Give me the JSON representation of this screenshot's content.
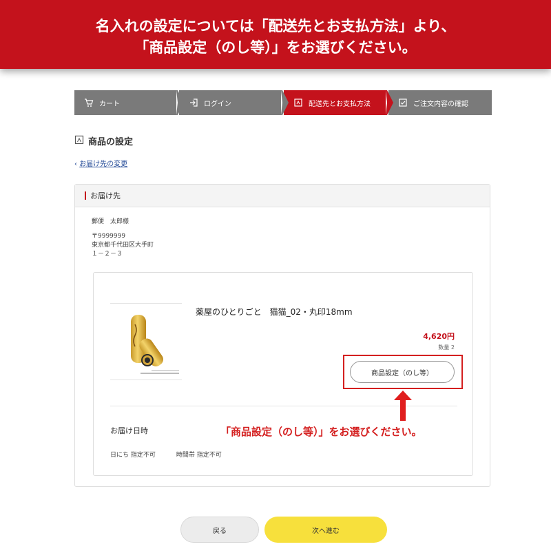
{
  "banner": {
    "line1": "名入れの設定については「配送先とお支払方法」より、",
    "line2": "「商品設定（のし等）」をお選びください。"
  },
  "steps": [
    {
      "label": "カート",
      "icon": "cart-icon",
      "active": false
    },
    {
      "label": "ログイン",
      "icon": "login-icon",
      "active": false
    },
    {
      "label": "配送先とお支払方法",
      "icon": "document-icon",
      "active": true
    },
    {
      "label": "ご注文内容の確認",
      "icon": "checkbox-icon",
      "active": false
    }
  ],
  "page": {
    "title": "商品の設定",
    "back_link": "お届け先の変更"
  },
  "delivery": {
    "header": "お届け先",
    "name": "郵便　太郎様",
    "postal": "〒9999999",
    "address1": "東京都千代田区大手町",
    "address2": "１－２－３"
  },
  "product": {
    "name": "薬屋のひとりごと　猫猫_02・丸印18mm",
    "price": "4,620円",
    "quantity": "数量 2",
    "setting_button": "商品設定（のし等）"
  },
  "delivery_date": {
    "title": "お届け日時",
    "date": "日にち 指定不可",
    "time": "時間帯 指定不可"
  },
  "annotation": {
    "callout": "「商品設定（のし等）」をお選びください。"
  },
  "footer": {
    "back_label": "戻る",
    "next_label": "次へ進む"
  },
  "colors": {
    "brand_red": "#c4121c",
    "step_gray": "#7a7a7a",
    "next_yellow": "#f7e03c"
  }
}
